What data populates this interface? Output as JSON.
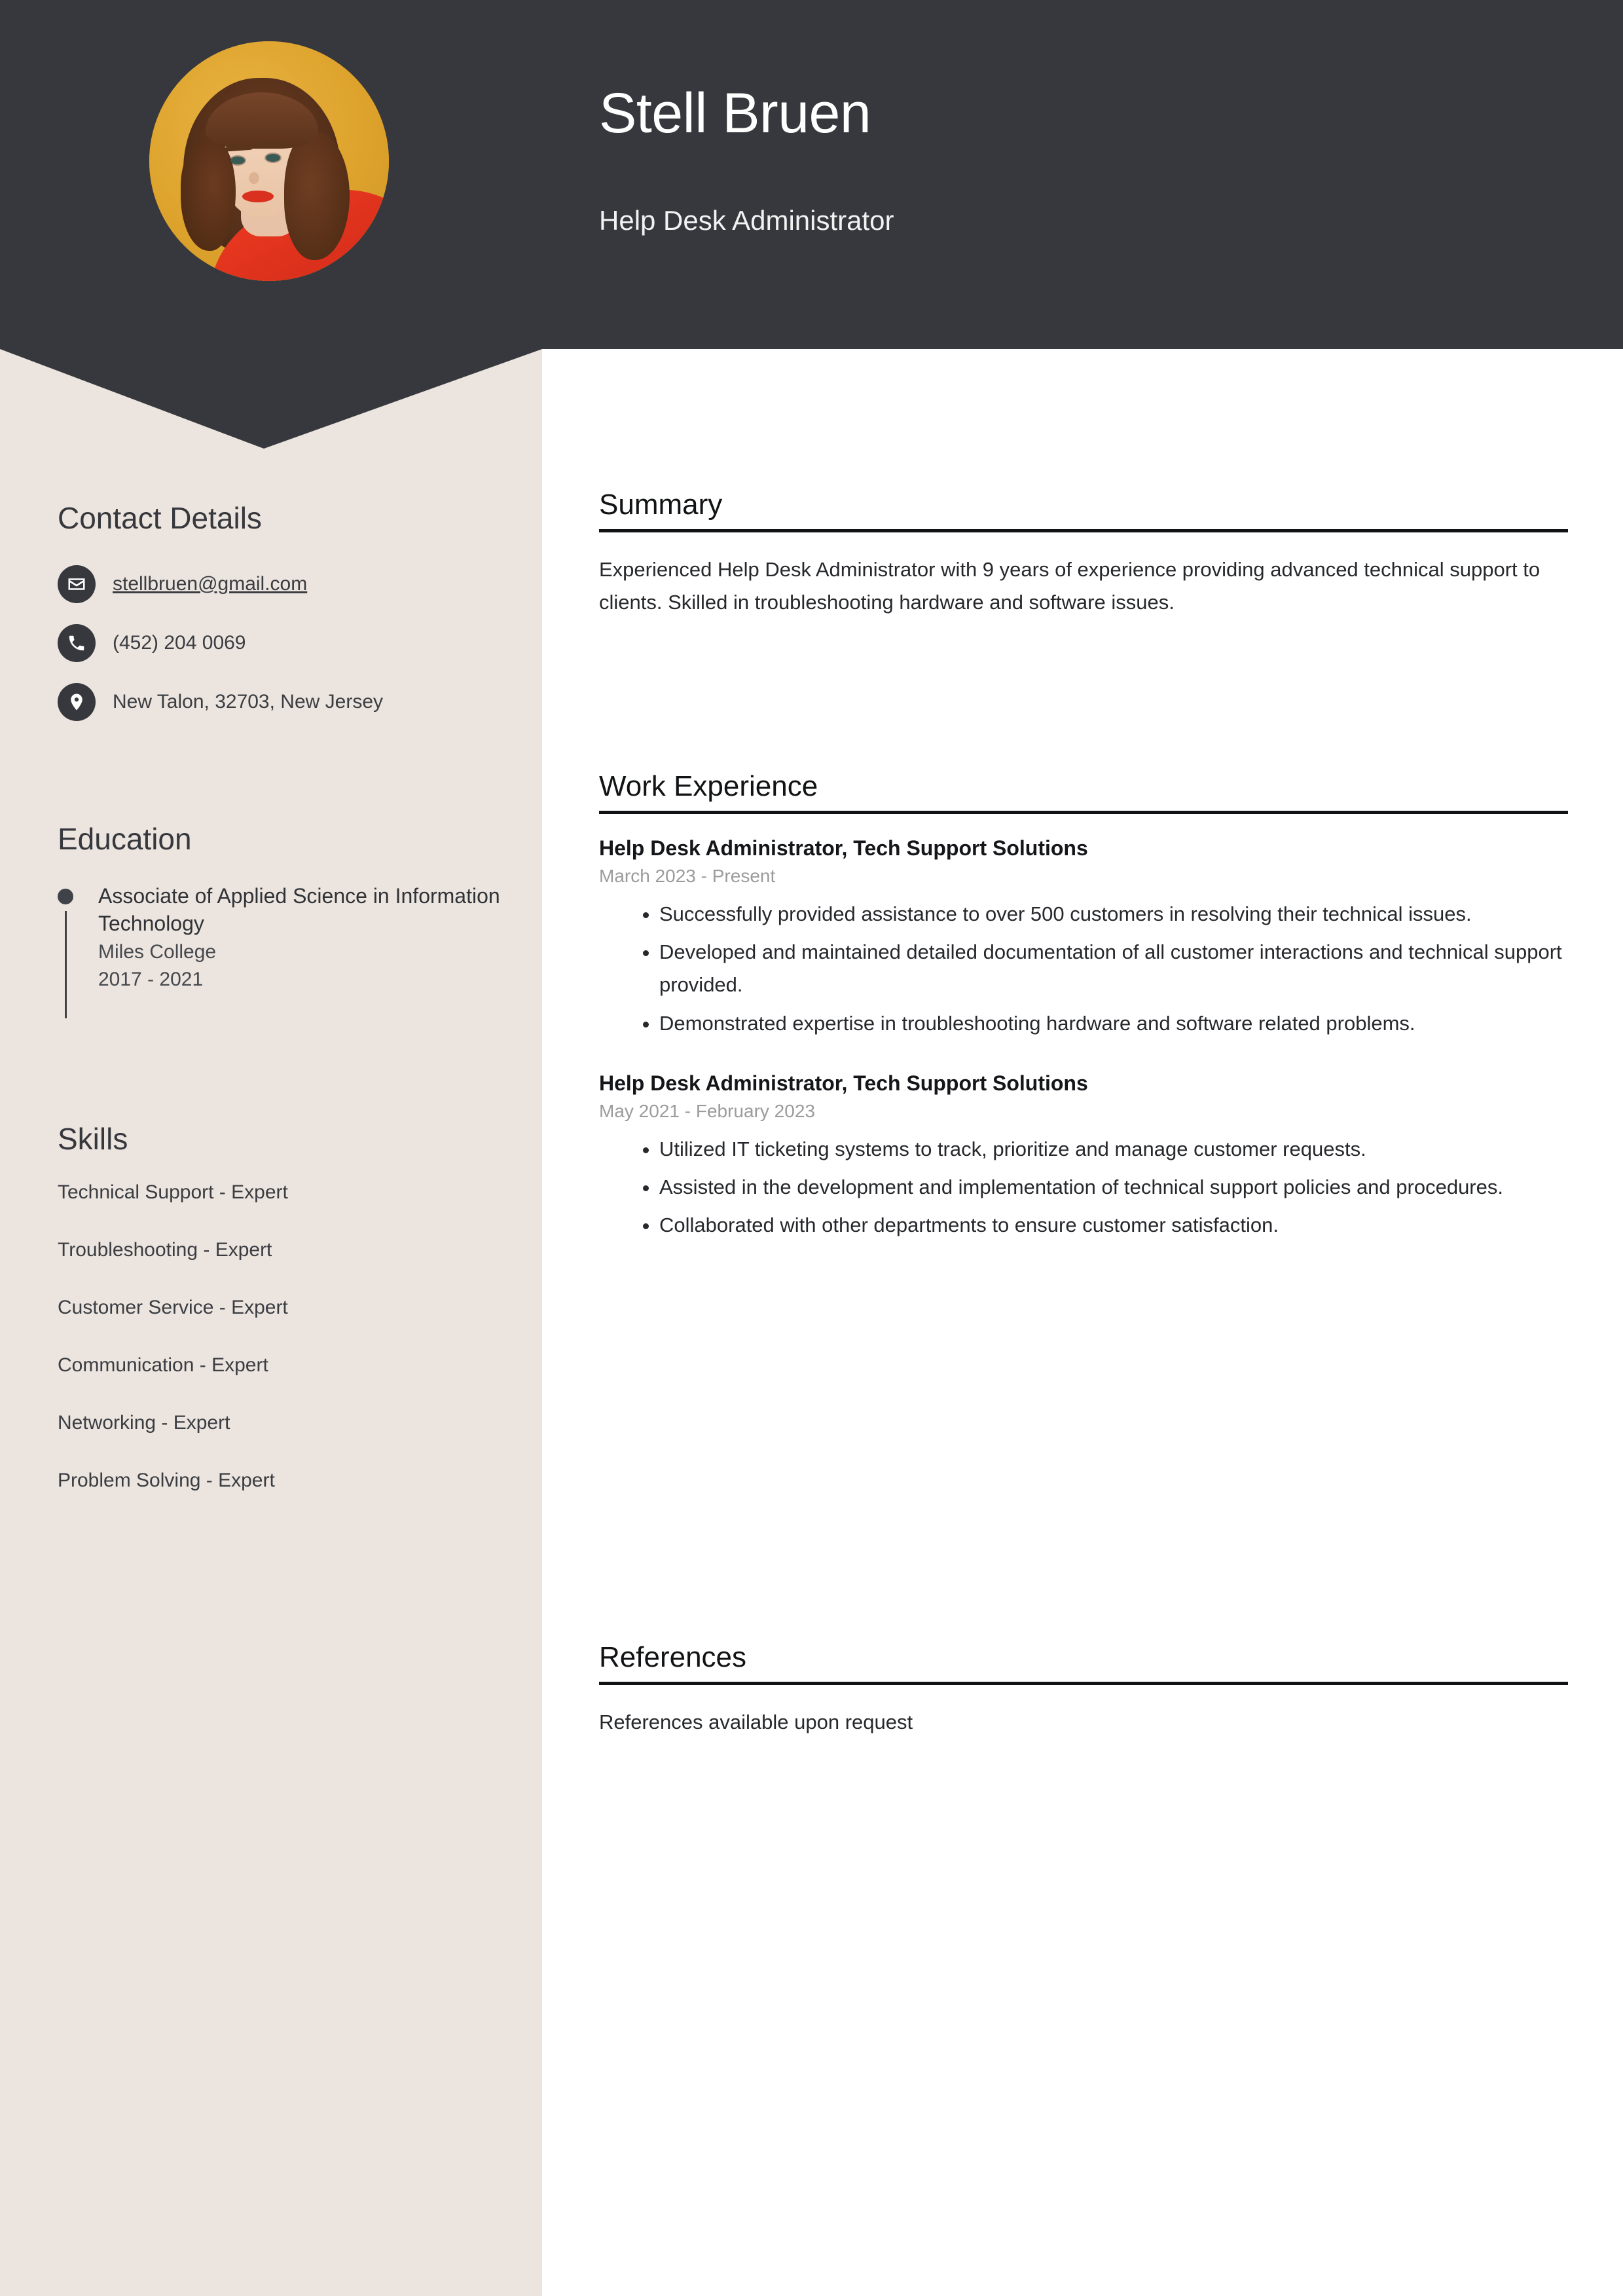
{
  "header": {
    "name": "Stell Bruen",
    "role": "Help Desk Administrator",
    "avatar_icon": "portrait-photo",
    "background_color": "#36383d",
    "avatar_background_color": "#dfa42f"
  },
  "sidebar": {
    "background_color": "#ece4de",
    "contact": {
      "heading": "Contact Details",
      "items": [
        {
          "icon": "envelope-icon",
          "value": "stellbruen@gmail.com",
          "kind": "email"
        },
        {
          "icon": "phone-icon",
          "value": "(452) 204 0069",
          "kind": "phone"
        },
        {
          "icon": "location-pin-icon",
          "value": "New Talon, 32703, New Jersey",
          "kind": "address"
        }
      ]
    },
    "education": {
      "heading": "Education",
      "items": [
        {
          "degree": "Associate of Applied Science in Information Technology",
          "school": "Miles College",
          "years": "2017 - 2021"
        }
      ]
    },
    "skills": {
      "heading": "Skills",
      "items": [
        "Technical Support - Expert",
        "Troubleshooting - Expert",
        "Customer Service - Expert",
        "Communication - Expert",
        "Networking - Expert",
        "Problem Solving - Expert"
      ]
    }
  },
  "main": {
    "summary": {
      "heading": "Summary",
      "text": "Experienced Help Desk Administrator with 9 years of experience providing advanced technical support to clients. Skilled in troubleshooting hardware and software issues."
    },
    "work_experience": {
      "heading": "Work Experience",
      "jobs": [
        {
          "title": "Help Desk Administrator, Tech Support Solutions",
          "dates": "March 2023 - Present",
          "bullets": [
            "Successfully provided assistance to over 500 customers in resolving their technical issues.",
            "Developed and maintained detailed documentation of all customer interactions and technical support provided.",
            "Demonstrated expertise in troubleshooting hardware and software related problems."
          ]
        },
        {
          "title": "Help Desk Administrator, Tech Support Solutions",
          "dates": "May 2021 - February 2023",
          "bullets": [
            "Utilized IT ticketing systems to track, prioritize and manage customer requests.",
            "Assisted in the development and implementation of technical support policies and procedures.",
            "Collaborated with other departments to ensure customer satisfaction."
          ]
        }
      ]
    },
    "references": {
      "heading": "References",
      "text": "References available upon request"
    }
  }
}
